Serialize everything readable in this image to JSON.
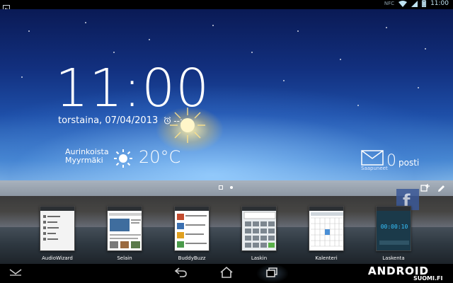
{
  "status_bar": {
    "time": "11:00",
    "icons": [
      "image-notification-icon",
      "nfc-icon",
      "wifi-icon",
      "signal-icon",
      "battery-icon"
    ],
    "nfc_label": "NFC"
  },
  "lockscreen": {
    "clock": "11:00",
    "date": "torstaina, 07/04/2013",
    "alarm": "--:--"
  },
  "weather": {
    "label": "Aurinkoista",
    "city": "Myyrmäki",
    "temperature": "20°C"
  },
  "mail": {
    "count": "0",
    "label": "posti",
    "sub_label": "Saapuneet"
  },
  "recents": {
    "apps": [
      {
        "label": "AudioWizard"
      },
      {
        "label": "Selain"
      },
      {
        "label": "BuddyBuzz"
      },
      {
        "label": "Laskin"
      },
      {
        "label": "Kalenteri"
      },
      {
        "label": "Laskenta"
      }
    ],
    "stopwatch": "00:00:10"
  },
  "navigation": {
    "buttons": [
      "hide-keyboard-icon",
      "back-icon",
      "home-icon",
      "recent-apps-icon"
    ]
  },
  "watermark": {
    "brand": "ANDROID",
    "domain": "SUOMI.FI"
  },
  "colors": {
    "sky_top": "#0a1a55",
    "sky_bottom": "#88bde9",
    "status_accent": "#bfe3f2",
    "facebook": "#3b5998",
    "stopwatch_bg": "#1b3a4a",
    "stopwatch_text": "#36c3ff"
  }
}
